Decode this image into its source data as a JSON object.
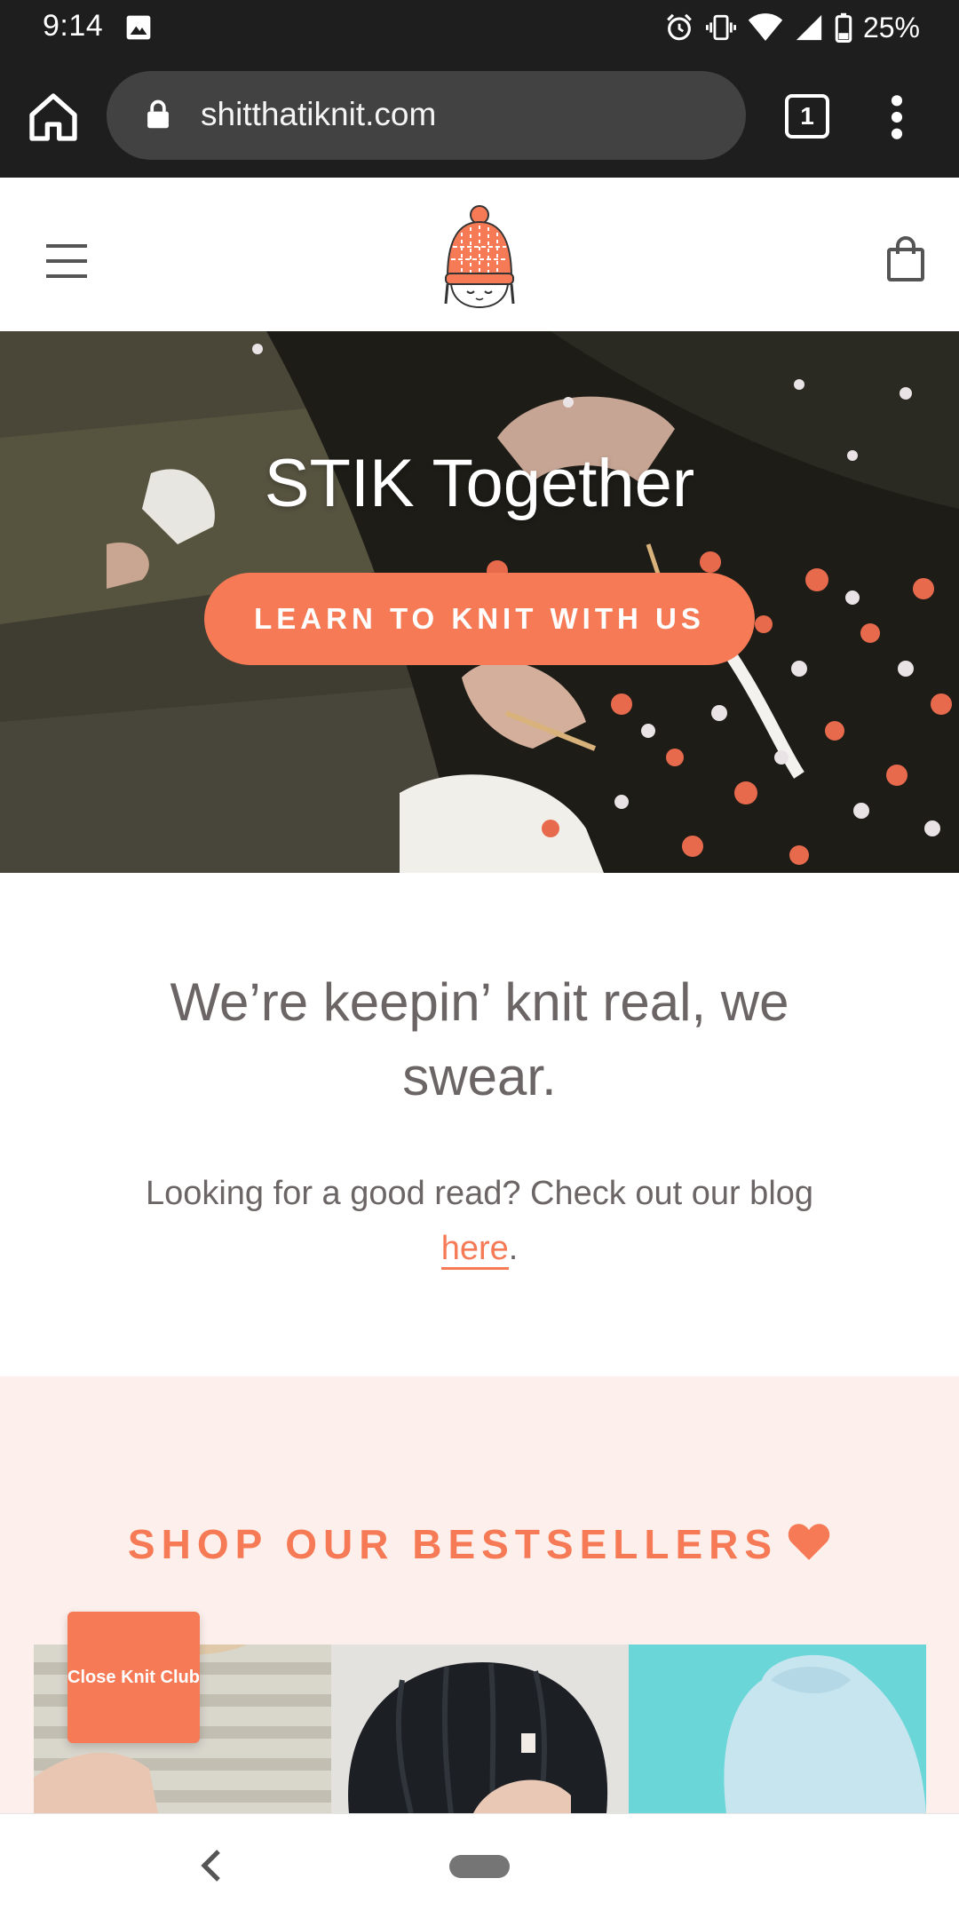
{
  "status_bar": {
    "time": "9:14",
    "battery": "25%",
    "icons": [
      "image-icon",
      "alarm-icon",
      "vibrate-icon",
      "wifi-icon",
      "signal-icon",
      "battery-icon"
    ]
  },
  "browser": {
    "url": "shitthatiknit.com",
    "tab_count": "1",
    "icons": [
      "home-icon",
      "lock-icon",
      "tabs-icon",
      "more-vert-icon"
    ]
  },
  "header": {
    "icons": [
      "hamburger-menu-icon",
      "knit-hat-logo",
      "shopping-bag-icon"
    ]
  },
  "hero": {
    "title": "STIK Together",
    "cta_label": "LEARN TO KNIT WITH US"
  },
  "intro": {
    "heading": "We’re keepin’ knit real, we swear.",
    "body_prefix": "Looking for a good read? Check out our blog ",
    "link_text": "here",
    "body_suffix": "."
  },
  "bestsellers": {
    "heading": "SHOP OUR BESTSELLERS",
    "products": [
      "striped-sweater-image",
      "black-beanie-image",
      "light-blue-sweater-image"
    ]
  },
  "knit_club": {
    "label": "Close Knit Club"
  },
  "nav": {
    "icons": [
      "back-icon",
      "home-pill"
    ]
  },
  "colors": {
    "accent": "#f57a55",
    "text": "#6c6565",
    "section_bg": "#fdf0ec",
    "browser_bg": "#1e1e1e",
    "url_pill": "#424242"
  }
}
